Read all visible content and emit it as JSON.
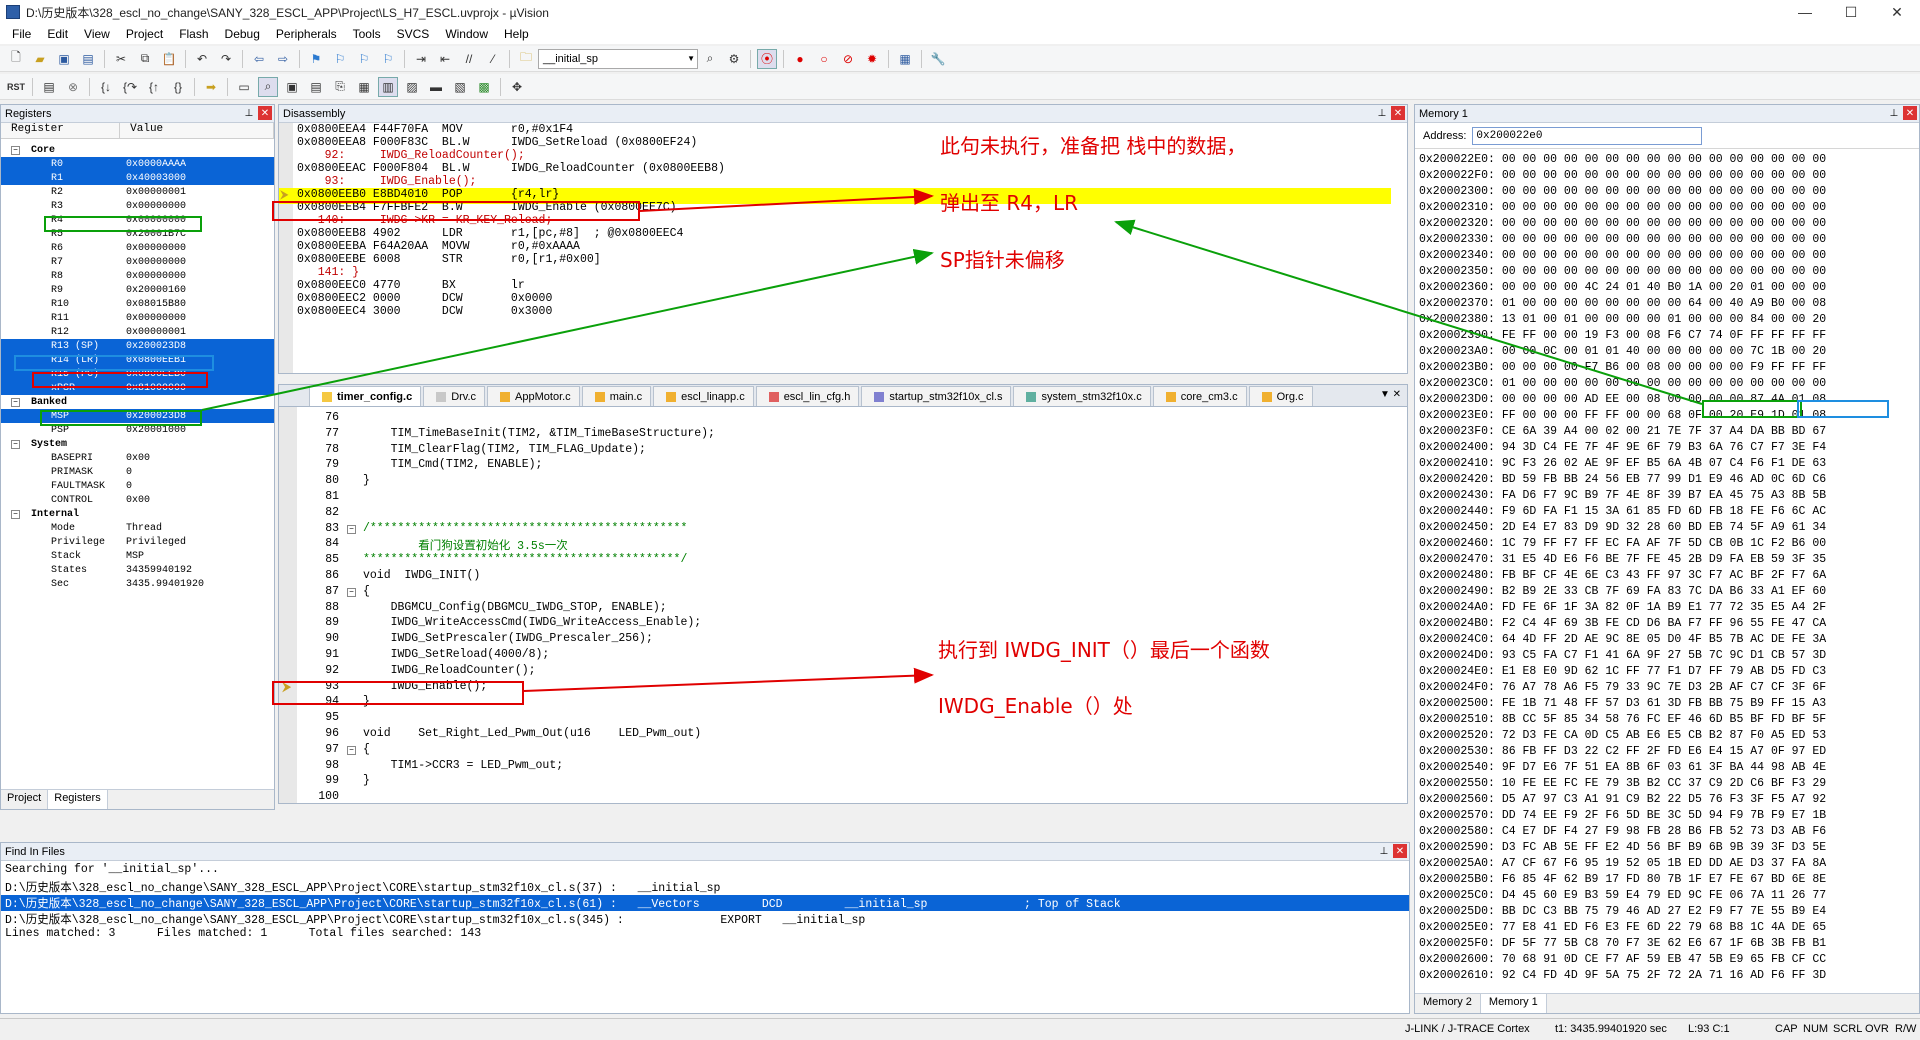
{
  "window": {
    "title": "D:\\历史版本\\328_escl_no_change\\SANY_328_ESCL_APP\\Project\\LS_H7_ESCL.uvprojx - µVision",
    "min": "—",
    "max": "☐",
    "close": "✕"
  },
  "menu": [
    "File",
    "Edit",
    "View",
    "Project",
    "Flash",
    "Debug",
    "Peripherals",
    "Tools",
    "SVCS",
    "Window",
    "Help"
  ],
  "toolbar": {
    "find_combo": "__initial_sp"
  },
  "registers": {
    "title": "Registers",
    "col_register": "Register",
    "col_value": "Value",
    "core_label": "Core",
    "rows": [
      {
        "name": "R0",
        "value": "0x0000AAAA"
      },
      {
        "name": "R1",
        "value": "0x40003000"
      },
      {
        "name": "R2",
        "value": "0x00000001"
      },
      {
        "name": "R3",
        "value": "0x00000000"
      },
      {
        "name": "R4",
        "value": "0x00000000"
      },
      {
        "name": "R5",
        "value": "0x20001B7C"
      },
      {
        "name": "R6",
        "value": "0x00000000"
      },
      {
        "name": "R7",
        "value": "0x00000000"
      },
      {
        "name": "R8",
        "value": "0x00000000"
      },
      {
        "name": "R9",
        "value": "0x20000160"
      },
      {
        "name": "R10",
        "value": "0x08015B80"
      },
      {
        "name": "R11",
        "value": "0x00000000"
      },
      {
        "name": "R12",
        "value": "0x00000001"
      },
      {
        "name": "R13 (SP)",
        "value": "0x200023D8"
      },
      {
        "name": "R14 (LR)",
        "value": "0x0800EEB1"
      },
      {
        "name": "R15 (PC)",
        "value": "0x0800EEB0"
      },
      {
        "name": "xPSR",
        "value": "0x81000000"
      }
    ],
    "banked_label": "Banked",
    "banked": [
      {
        "name": "MSP",
        "value": "0x200023D8"
      },
      {
        "name": "PSP",
        "value": "0x20001000"
      }
    ],
    "system_label": "System",
    "system": [
      {
        "name": "BASEPRI",
        "value": "0x00"
      },
      {
        "name": "PRIMASK",
        "value": "0"
      },
      {
        "name": "FAULTMASK",
        "value": "0"
      },
      {
        "name": "CONTROL",
        "value": "0x00"
      }
    ],
    "internal_label": "Internal",
    "internal": [
      {
        "name": "Mode",
        "value": "Thread"
      },
      {
        "name": "Privilege",
        "value": "Privileged"
      },
      {
        "name": "Stack",
        "value": "MSP"
      },
      {
        "name": "States",
        "value": "34359940192"
      },
      {
        "name": "Sec",
        "value": "3435.99401920"
      }
    ],
    "tab_project": "Project",
    "tab_registers": "Registers"
  },
  "disassembly": {
    "title": "Disassembly",
    "lines": [
      "0x0800EEA4 F44F70FA  MOV       r0,#0x1F4",
      "0x0800EEA8 F000F83C  BL.W      IWDG_SetReload (0x0800EF24)",
      "    92:     IWDG_ReloadCounter();",
      "0x0800EEAC F000F804  BL.W      IWDG_ReloadCounter (0x0800EEB8)",
      "    93:     IWDG_Enable();",
      "0x0800EEB0 E8BD4010  POP       {r4,lr}",
      "0x0800EEB4 F7FFBFE2  B.W       IWDG_Enable (0x0800EE7C)",
      "   140:     IWDG->KR = KR_KEY_Reload;",
      "0x0800EEB8 4902      LDR       r1,[pc,#8]  ; @0x0800EEC4",
      "0x0800EEBA F64A20AA  MOVW      r0,#0xAAAA",
      "0x0800EEBE 6008      STR       r0,[r1,#0x00]",
      "   141: }",
      "0x0800EEC0 4770      BX        lr",
      "0x0800EEC2 0000      DCW       0x0000",
      "0x0800EEC4 3000      DCW       0x3000"
    ]
  },
  "editor": {
    "tabs": [
      "timer_config.c",
      "Drv.c",
      "AppMotor.c",
      "main.c",
      "escl_linapp.c",
      "escl_lin_cfg.h",
      "startup_stm32f10x_cl.s",
      "system_stm32f10x.c",
      "core_cm3.c",
      "Org.c"
    ],
    "lines": [
      {
        "n": "76",
        "t": ""
      },
      {
        "n": "77",
        "t": "    TIM_TimeBaseInit(TIM2, &TIM_TimeBaseStructure);"
      },
      {
        "n": "78",
        "t": "    TIM_ClearFlag(TIM2, TIM_FLAG_Update);"
      },
      {
        "n": "79",
        "t": "    TIM_Cmd(TIM2, ENABLE);"
      },
      {
        "n": "80",
        "t": "}"
      },
      {
        "n": "81",
        "t": ""
      },
      {
        "n": "82",
        "t": ""
      },
      {
        "n": "83",
        "t": "/**********************************************"
      },
      {
        "n": "84",
        "t": "        看门狗设置初始化 3.5s一次"
      },
      {
        "n": "85",
        "t": "**********************************************/"
      },
      {
        "n": "86",
        "t": "void  IWDG_INIT()"
      },
      {
        "n": "87",
        "t": "{"
      },
      {
        "n": "88",
        "t": "    DBGMCU_Config(DBGMCU_IWDG_STOP, ENABLE);"
      },
      {
        "n": "89",
        "t": "    IWDG_WriteAccessCmd(IWDG_WriteAccess_Enable);"
      },
      {
        "n": "90",
        "t": "    IWDG_SetPrescaler(IWDG_Prescaler_256);"
      },
      {
        "n": "91",
        "t": "    IWDG_SetReload(4000/8);"
      },
      {
        "n": "92",
        "t": "    IWDG_ReloadCounter();"
      },
      {
        "n": "93",
        "t": "    IWDG_Enable();"
      },
      {
        "n": "94",
        "t": "}"
      },
      {
        "n": "95",
        "t": ""
      },
      {
        "n": "96",
        "t": "void    Set_Right_Led_Pwm_Out(u16    LED_Pwm_out)"
      },
      {
        "n": "97",
        "t": "{"
      },
      {
        "n": "98",
        "t": "    TIM1->CCR3 = LED_Pwm_out;"
      },
      {
        "n": "99",
        "t": "}"
      },
      {
        "n": "100",
        "t": ""
      }
    ]
  },
  "find": {
    "title": "Find In Files",
    "lines": [
      "Searching for '__initial_sp'...",
      "D:\\历史版本\\328_escl_no_change\\SANY_328_ESCL_APP\\Project\\CORE\\startup_stm32f10x_cl.s(37) :   __initial_sp",
      "D:\\历史版本\\328_escl_no_change\\SANY_328_ESCL_APP\\Project\\CORE\\startup_stm32f10x_cl.s(61) :   __Vectors         DCD         __initial_sp              ; Top of Stack",
      "D:\\历史版本\\328_escl_no_change\\SANY_328_ESCL_APP\\Project\\CORE\\startup_stm32f10x_cl.s(345) :              EXPORT   __initial_sp",
      "Lines matched: 3      Files matched: 1      Total files searched: 143"
    ]
  },
  "memory": {
    "title": "Memory 1",
    "address_label": "Address:",
    "address_value": "0x200022e0",
    "lines": [
      "0x200022E0: 00 00 00 00 00 00 00 00 00 00 00 00 00 00 00 00",
      "0x200022F0: 00 00 00 00 00 00 00 00 00 00 00 00 00 00 00 00",
      "0x20002300: 00 00 00 00 00 00 00 00 00 00 00 00 00 00 00 00",
      "0x20002310: 00 00 00 00 00 00 00 00 00 00 00 00 00 00 00 00",
      "0x20002320: 00 00 00 00 00 00 00 00 00 00 00 00 00 00 00 00",
      "0x20002330: 00 00 00 00 00 00 00 00 00 00 00 00 00 00 00 00",
      "0x20002340: 00 00 00 00 00 00 00 00 00 00 00 00 00 00 00 00",
      "0x20002350: 00 00 00 00 00 00 00 00 00 00 00 00 00 00 00 00",
      "0x20002360: 00 00 00 00 4C 24 01 40 B0 1A 00 20 01 00 00 00",
      "0x20002370: 01 00 00 00 00 00 00 00 00 64 00 40 A9 B0 00 08",
      "0x20002380: 13 01 00 01 00 00 00 00 01 00 00 00 84 00 00 20",
      "0x20002390: FE FF 00 00 19 F3 00 08 F6 C7 74 0F FF FF FF FF",
      "0x200023A0: 00 00 0C 00 01 01 40 00 00 00 00 00 7C 1B 00 20",
      "0x200023B0: 00 00 00 00 F7 B6 00 08 00 00 00 00 F9 FF FF FF",
      "0x200023C0: 01 00 00 00 00 00 00 00 00 00 00 00 00 00 00 00",
      "0x200023D0: 00 00 00 00 AD EE 00 08 00 00 00 00 87 4A 01 08",
      "0x200023E0: FF 00 00 00 FF FF 00 00 68 0F 00 20 E9 1D 01 08",
      "0x200023F0: CE 6A 39 A4 00 02 00 21 7E 7F 37 A4 DA BB BD 67",
      "0x20002400: 94 3D C4 FE 7F 4F 9E 6F 79 B3 6A 76 C7 F7 3E F4",
      "0x20002410: 9C F3 26 02 AE 9F EF B5 6A 4B 07 C4 F6 F1 DE 63",
      "0x20002420: BD 59 FB BB 24 56 EB 77 99 D1 E9 46 AD 0C 6D C6",
      "0x20002430: FA D6 F7 9C B9 7F 4E 8F 39 B7 EA 45 75 A3 8B 5B",
      "0x20002440: F9 6D FA F1 15 3A 61 85 FD 6D FB 18 FE F6 6C AC",
      "0x20002450: 2D E4 E7 83 D9 9D 32 28 60 BD EB 74 5F A9 61 34",
      "0x20002460: 1C 79 FF F7 FF EC FA AF 7F 5D CB 0B 1C F2 B6 00",
      "0x20002470: 31 E5 4D E6 F6 BE 7F FE 45 2B D9 FA EB 59 3F 35",
      "0x20002480: FB BF CF 4E 6E C3 43 FF 97 3C F7 AC BF 2F F7 6A",
      "0x20002490: B2 B9 2E 33 CB 7F 69 FA 83 7C DA B6 33 A1 EF 60",
      "0x200024A0: FD FE 6F 1F 3A 82 0F 1A B9 E1 77 72 35 E5 A4 2F",
      "0x200024B0: F2 C4 4F 69 3B FE CD D6 BA F7 FF 96 55 FE 47 CA",
      "0x200024C0: 64 4D FF 2D AE 9C 8E 05 D0 4F B5 7B AC DE FE 3A",
      "0x200024D0: 93 C5 FA C7 F1 41 6A 9F 27 5B 7C 9C D1 CB 57 3D",
      "0x200024E0: E1 E8 E0 9D 62 1C FF 77 F1 D7 FF 79 AB D5 FD C3",
      "0x200024F0: 76 A7 78 A6 F5 79 33 9C 7E D3 2B AF C7 CF 3F 6F",
      "0x20002500: FE 1B 71 48 FF 57 D3 61 3D FB BB 75 B9 FF 15 A3",
      "0x20002510: 8B CC 5F 85 34 58 76 FC EF 46 6D B5 BF FD BF 5F",
      "0x20002520: 72 D3 FE CA 0D C5 AB E6 E5 CB B2 87 F0 A5 ED 53",
      "0x20002530: 86 FB FF D3 22 C2 FF 2F FD E6 E4 15 A7 0F 97 ED",
      "0x20002540: 9F D7 E6 7F 51 EA 8B 6F 03 61 3F BA 44 98 AB 4E",
      "0x20002550: 10 FE EE FC FE 79 3B B2 CC 37 C9 2D C6 BF F3 29",
      "0x20002560: D5 A7 97 C3 A1 91 C9 B2 22 D5 76 F3 3F F5 A7 92",
      "0x20002570: DD 74 EE F9 2F F6 5D BE 3C 5D 94 F9 7B F9 E7 1B",
      "0x20002580: C4 E7 DF F4 27 F9 98 FB 28 B6 FB 52 73 D3 AB F6",
      "0x20002590: D3 FC AB 5E FF E2 4D 56 BF B9 6B 9B 39 3F D3 5E",
      "0x200025A0: A7 CF 67 F6 95 19 52 05 1B ED DD AE D3 37 FA 8A",
      "0x200025B0: F6 85 4F 62 B9 17 FD 80 7B 1F E7 FE 67 BD 6E 8E",
      "0x200025C0: D4 45 60 E9 B3 59 E4 79 ED 9C FE 06 7A 11 26 77",
      "0x200025D0: BB DC C3 BB 75 79 46 AD 27 E2 F9 F7 7E 55 B9 E4",
      "0x200025E0: 77 E8 41 ED F6 E3 FE 6D 22 79 68 B8 1C 4A DE 65",
      "0x200025F0: DF 5F 77 5B C8 70 F7 3E 62 E6 67 1F 6B 3B FB B1",
      "0x20002600: 70 68 91 0D CE F7 AF 59 EB 47 5B E9 65 FB CF CC",
      "0x20002610: 92 C4 FD 4D 9F 5A 75 2F 72 2A 71 16 AD F6 FF 3D"
    ],
    "tab_memory2": "Memory 2",
    "tab_memory1": "Memory 1"
  },
  "status": {
    "debugger": "J-LINK / J-TRACE Cortex",
    "time": "t1: 3435.99401920 sec",
    "position": "L:93 C:1",
    "cap": "CAP",
    "num": "NUM",
    "scrl": "SCRL",
    "ovr": "OVR",
    "rw": "R/W"
  },
  "annotations": {
    "a1": "此句未执行，准备把 栈中的数据，",
    "a2": "弹出至 R4，LR",
    "a3": "SP指针未偏移",
    "a4": "执行到 IWDG_INIT（）最后一个函数",
    "a5": "IWDG_Enable（）处"
  },
  "colors": {
    "selection": "#0a64d6",
    "current_line": "#ffff00",
    "annotation_red": "#e00000",
    "annotation_green": "#0aa00a",
    "annotation_blue": "#1e8ee0"
  }
}
